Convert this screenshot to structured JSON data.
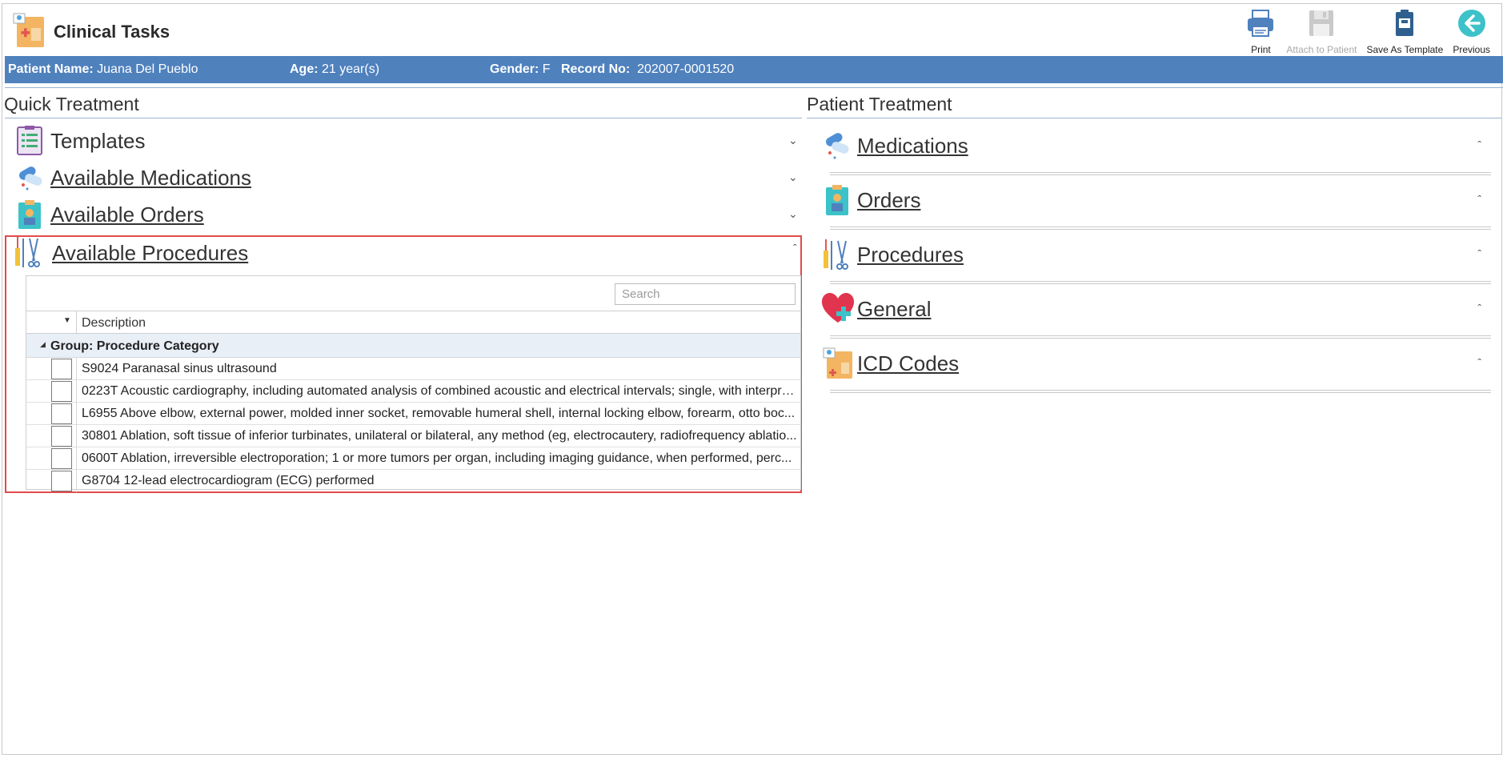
{
  "app": {
    "title": "Clinical Tasks"
  },
  "toolbar": {
    "print": "Print",
    "attach": "Attach to Patient",
    "save_template": "Save As Template",
    "previous": "Previous"
  },
  "patient": {
    "name_label": "Patient Name:",
    "name": "Juana Del Pueblo",
    "age_label": "Age:",
    "age": "21 year(s)",
    "gender_label": "Gender:",
    "gender": "F",
    "record_label": "Record No:",
    "record": "202007-0001520"
  },
  "quick_treatment": {
    "title": "Quick Treatment",
    "items": [
      {
        "label": "Templates",
        "icon": "clipboard-list-icon"
      },
      {
        "label": "Available Medications",
        "icon": "pills-icon"
      },
      {
        "label": "Available Orders",
        "icon": "orders-clipboard-icon"
      },
      {
        "label": "Available Procedures",
        "icon": "surgical-tools-icon"
      }
    ]
  },
  "procedures_grid": {
    "search_placeholder": "Search",
    "column_description": "Description",
    "group_label": "Group: Procedure Category",
    "rows": [
      "S9024 Paranasal sinus ultrasound",
      "0223T Acoustic cardiography, including automated analysis of combined acoustic and electrical intervals; single, with interpre...",
      "L6955 Above elbow, external power, molded inner socket, removable humeral shell, internal locking elbow, forearm, otto boc...",
      "30801 Ablation, soft tissue of inferior turbinates, unilateral or bilateral, any method (eg, electrocautery, radiofrequency ablatio...",
      "0600T Ablation, irreversible electroporation; 1 or more tumors per organ, including imaging guidance, when performed, perc...",
      "G8704 12-lead electrocardiogram (ECG) performed"
    ]
  },
  "patient_treatment": {
    "title": "Patient Treatment",
    "items": [
      {
        "label": "Medications",
        "icon": "pills-icon"
      },
      {
        "label": "Orders",
        "icon": "orders-clipboard-icon"
      },
      {
        "label": "Procedures",
        "icon": "surgical-tools-icon"
      },
      {
        "label": "General",
        "icon": "heart-plus-icon"
      },
      {
        "label": "ICD Codes",
        "icon": "icd-folder-icon"
      }
    ]
  },
  "colors": {
    "patient_bar": "#4f81bd",
    "highlight_border": "#e24a4a",
    "group_row_bg": "#e9eff7"
  }
}
